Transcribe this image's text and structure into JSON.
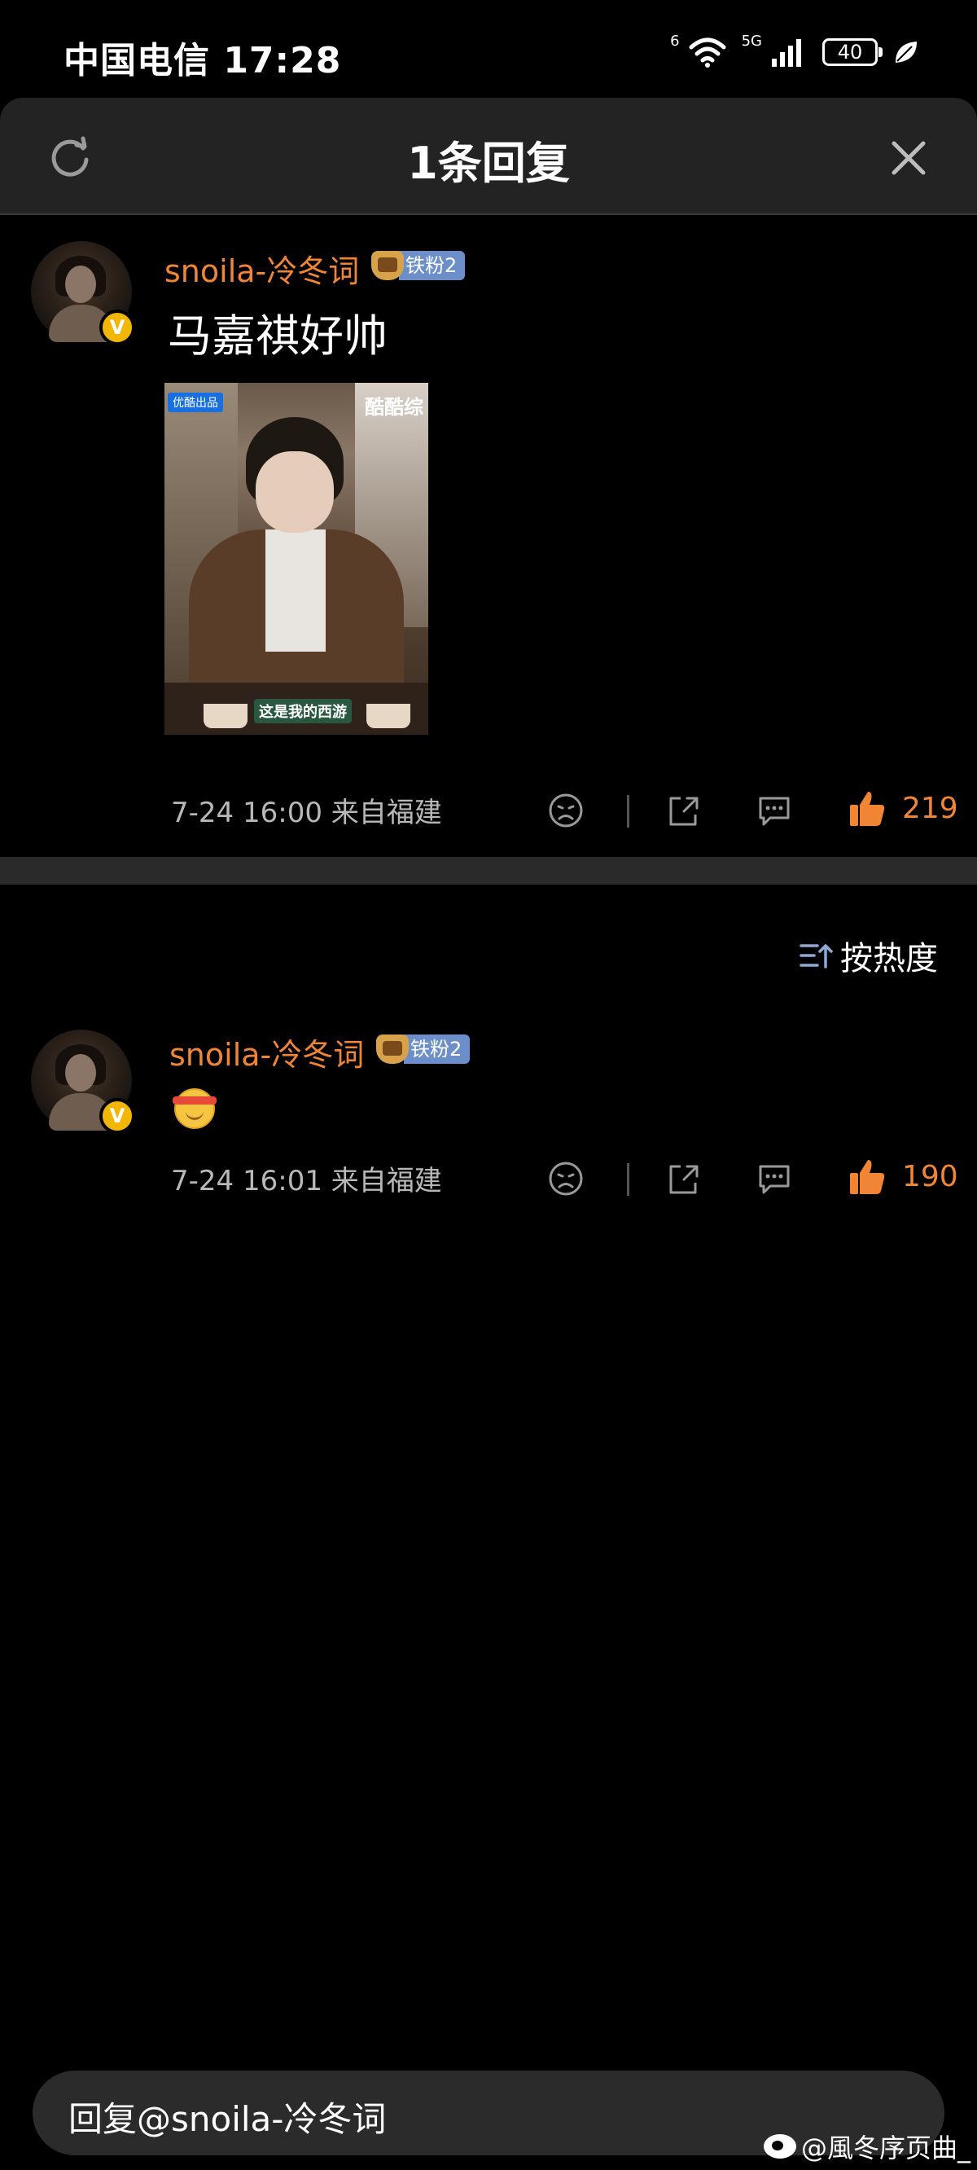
{
  "status_bar": {
    "carrier_time": "中国电信 17:28",
    "wifi_tag": "6",
    "network": "5G",
    "battery": "40"
  },
  "header": {
    "title": "1条回复"
  },
  "root_comment": {
    "username": "snoila-冷冬词",
    "fan_badge": "铁粉2",
    "text": "马嘉祺好帅",
    "image_tags": {
      "source": "优酷出品",
      "brand": "酷酷综",
      "show": "这是我的西游"
    },
    "meta": "7-24 16:00 来自福建",
    "likes": "219"
  },
  "sort": {
    "label": "按热度"
  },
  "reply_comment": {
    "username": "snoila-冷冬词",
    "fan_badge": "铁粉2",
    "meta": "7-24 16:01 来自福建",
    "likes": "190"
  },
  "reply_box": {
    "placeholder": "回复@snoila-冷冬词"
  },
  "watermark": {
    "text": "@風冬序页曲_"
  },
  "colors": {
    "accent": "#f08535",
    "fan_badge": "#6d8fc9",
    "verified": "#f2b705"
  }
}
